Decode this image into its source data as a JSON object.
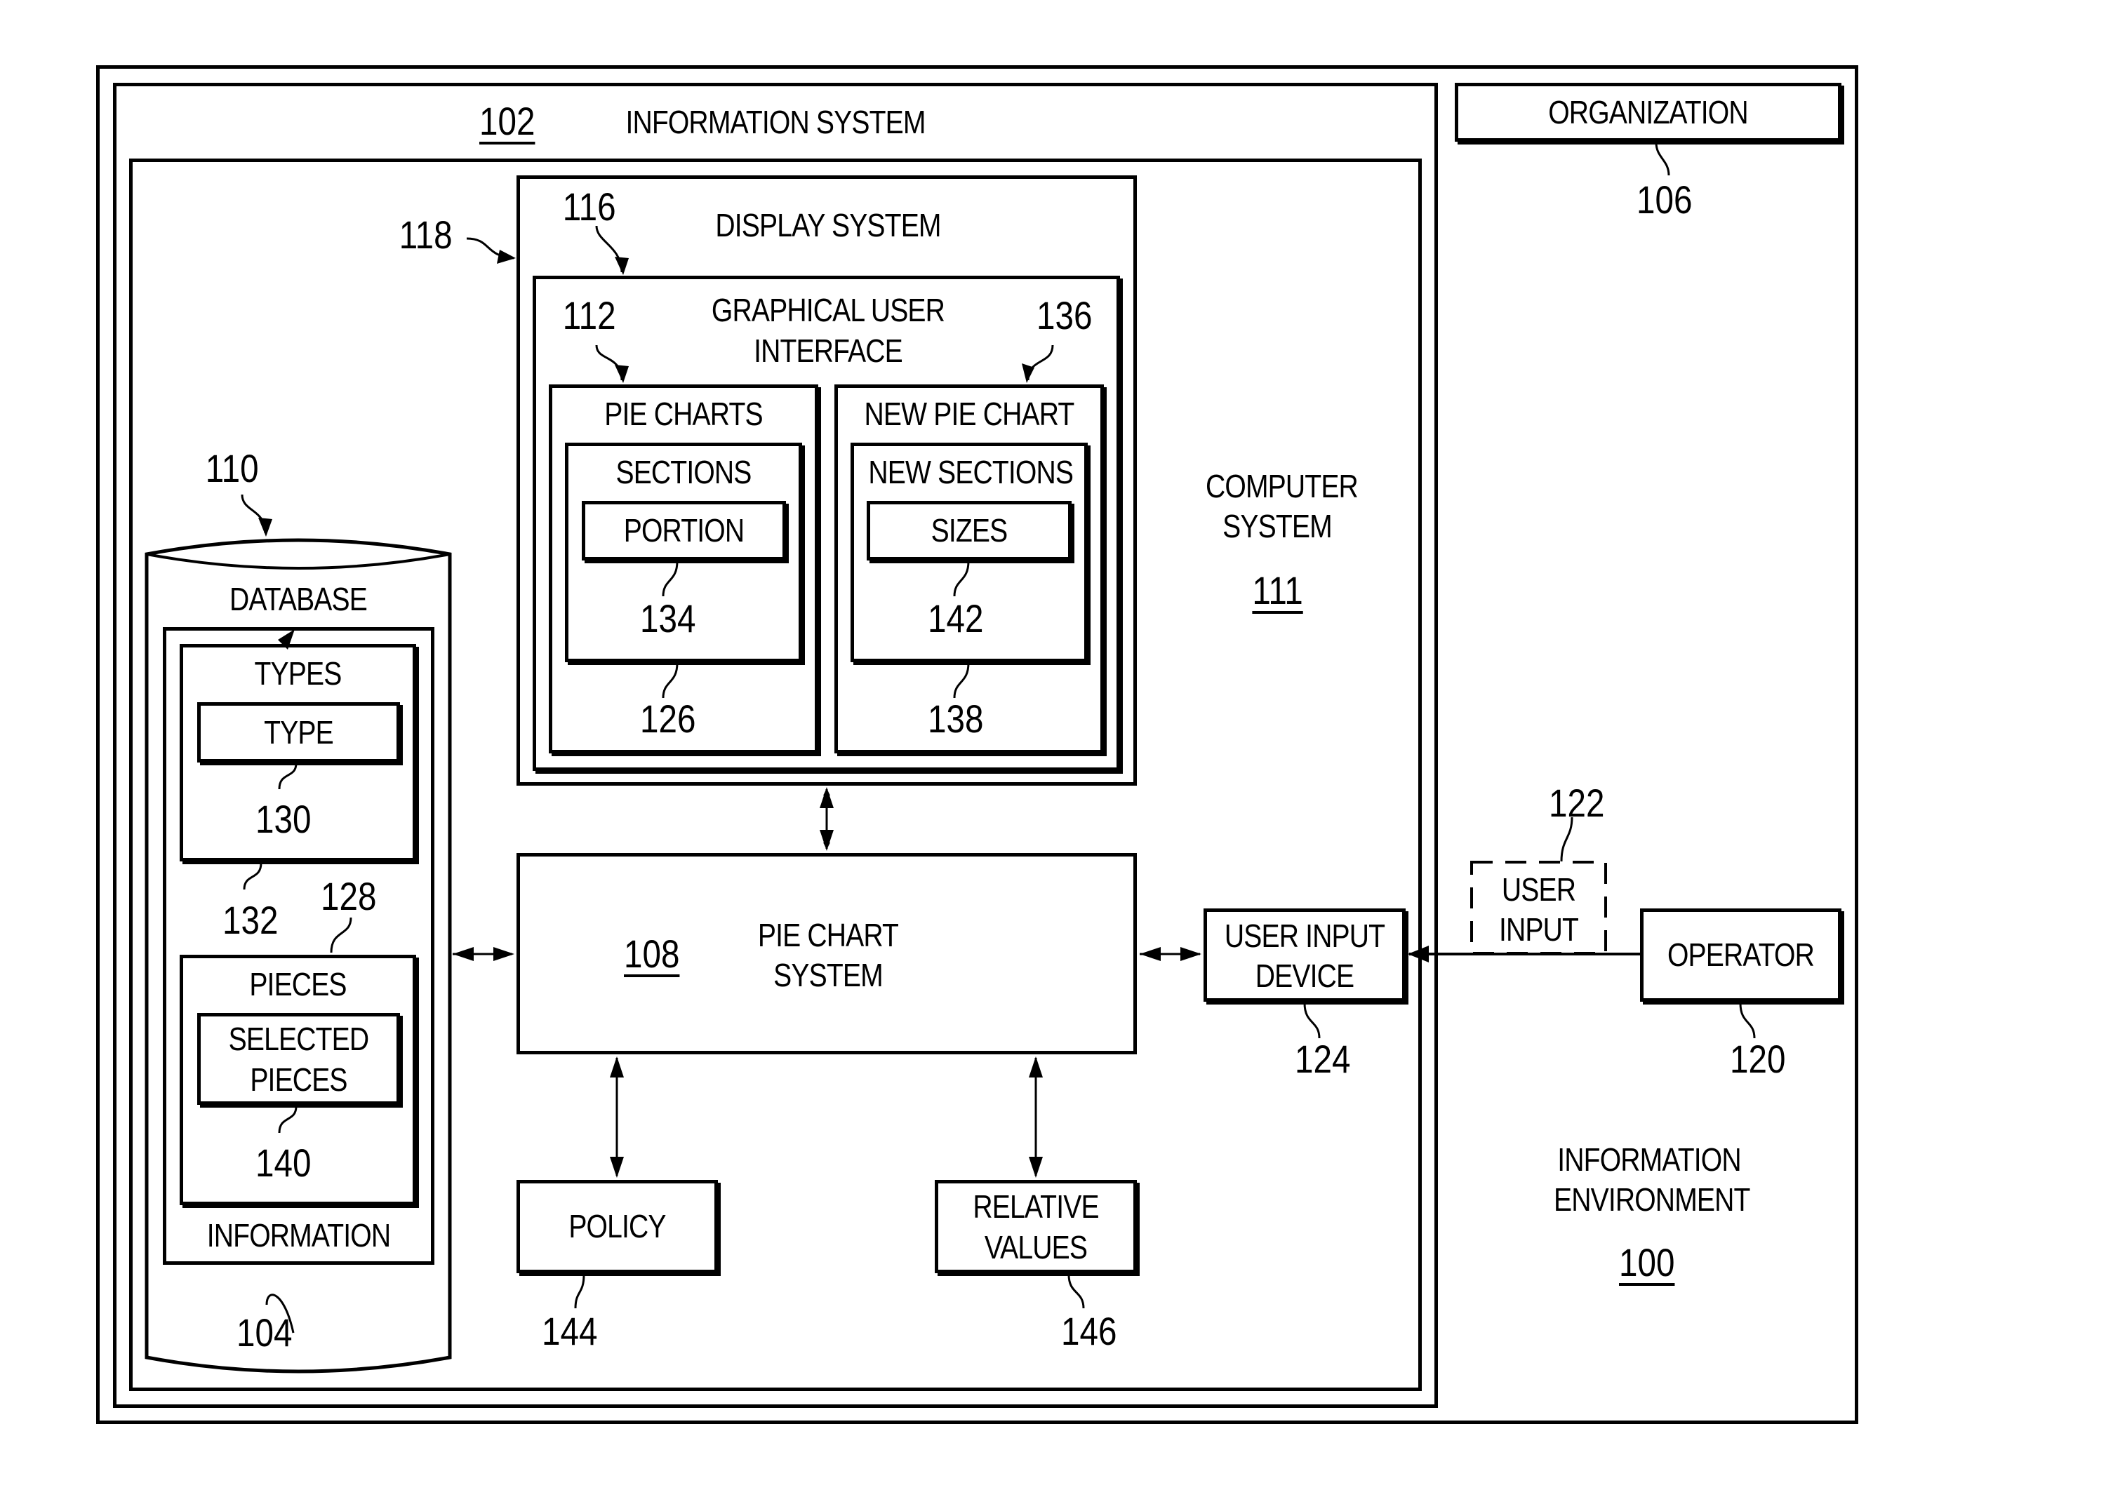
{
  "environment": {
    "title": "INFORMATION ENVIRONMENT",
    "ref": "100"
  },
  "organization": {
    "label": "ORGANIZATION",
    "ref": "106"
  },
  "information_system": {
    "label": "INFORMATION SYSTEM",
    "ref": "102"
  },
  "computer_system": {
    "label_line1": "COMPUTER",
    "label_line2": "SYSTEM",
    "ref": "111"
  },
  "display_system": {
    "label": "DISPLAY SYSTEM",
    "ref": "116",
    "ref_outer": "118"
  },
  "gui": {
    "label_line1": "GRAPHICAL USER",
    "label_line2": "INTERFACE",
    "ref": "112"
  },
  "pie_charts": {
    "label": "PIE CHARTS",
    "sections_label": "SECTIONS",
    "portion_label": "PORTION",
    "portion_ref": "134",
    "sections_ref": "126"
  },
  "new_pie_chart": {
    "label": "NEW PIE CHART",
    "ref": "136",
    "new_sections_label": "NEW SECTIONS",
    "sizes_label": "SIZES",
    "sizes_ref": "142",
    "new_sections_ref": "138"
  },
  "pie_chart_system": {
    "label_line1": "PIE CHART",
    "label_line2": "SYSTEM",
    "ref": "108"
  },
  "user_input_device": {
    "label_line1": "USER INPUT",
    "label_line2": "DEVICE",
    "ref": "124"
  },
  "user_input": {
    "label_line1": "USER",
    "label_line2": "INPUT",
    "ref": "122"
  },
  "operator": {
    "label": "OPERATOR",
    "ref": "120"
  },
  "policy": {
    "label": "POLICY",
    "ref": "144"
  },
  "relative_values": {
    "label_line1": "RELATIVE",
    "label_line2": "VALUES",
    "ref": "146"
  },
  "database": {
    "label": "DATABASE",
    "ref": "110",
    "information_label": "INFORMATION",
    "information_ref": "104",
    "types_label": "TYPES",
    "type_label": "TYPE",
    "type_ref": "130",
    "types_ref": "132",
    "pieces_label": "PIECES",
    "pieces_ref": "128",
    "selected_line1": "SELECTED",
    "selected_line2": "PIECES",
    "selected_ref": "140"
  }
}
